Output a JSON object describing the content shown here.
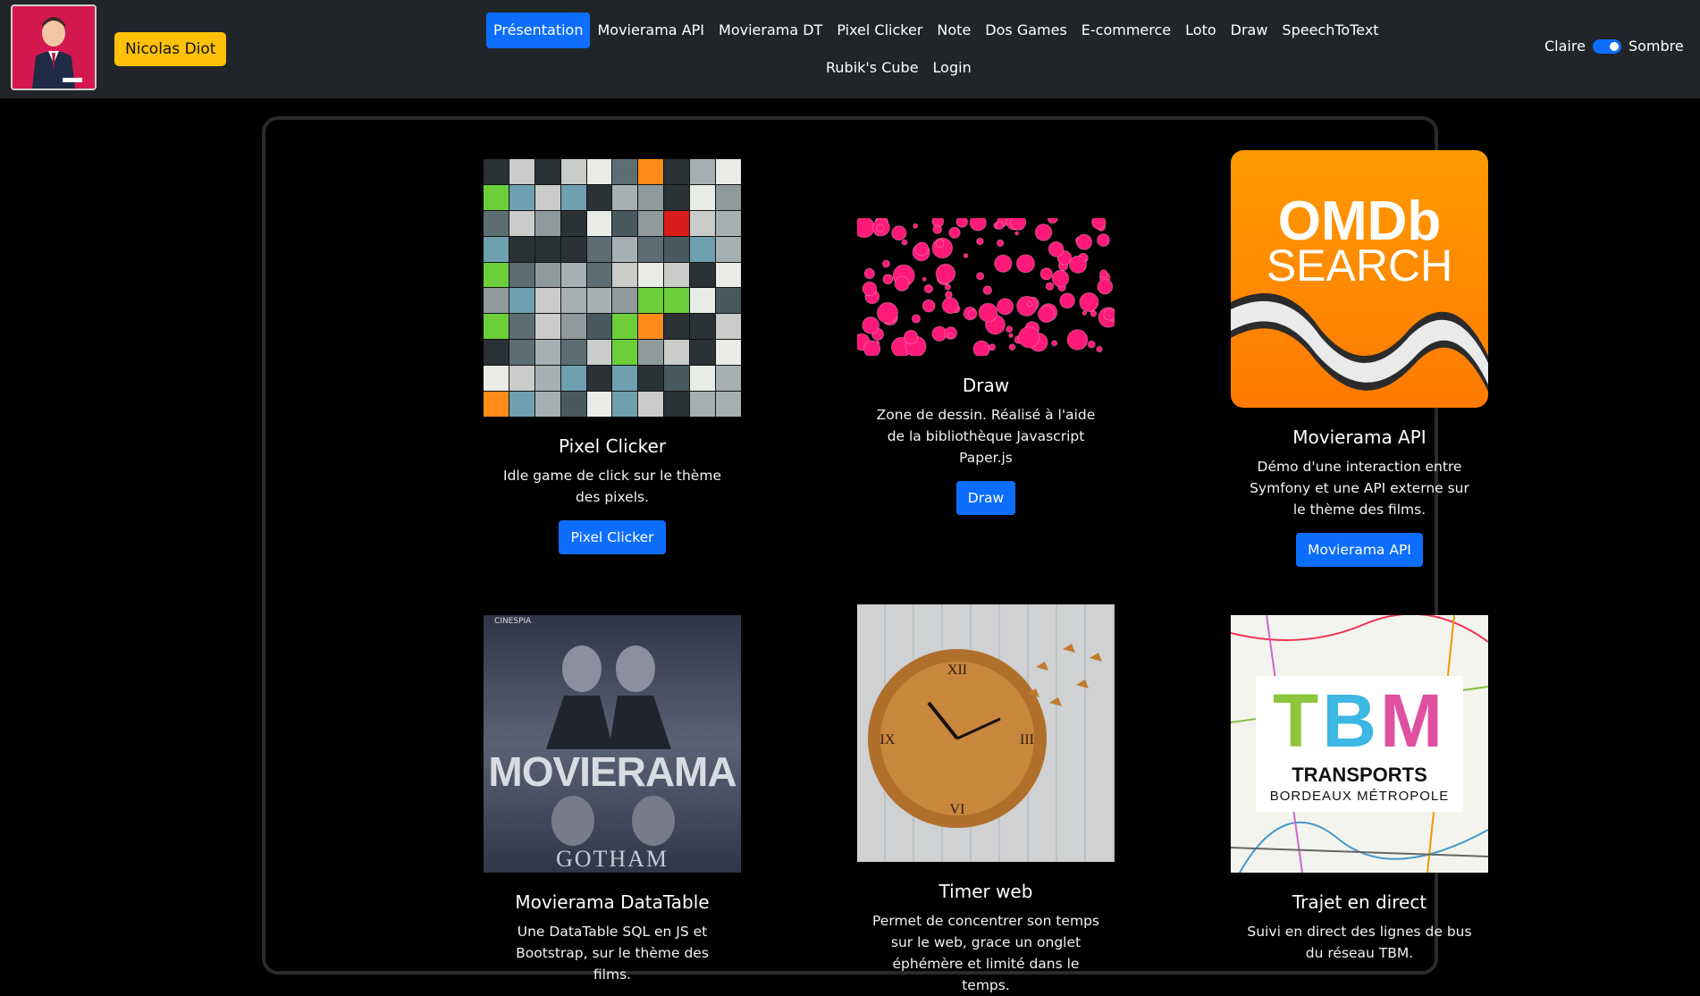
{
  "header": {
    "brand": "Nicolas Diot",
    "nav_row1": [
      "Présentation",
      "Movierama API",
      "Movierama DT",
      "Pixel Clicker",
      "Note",
      "Dos Games",
      "E-commerce",
      "Loto",
      "Draw",
      "SpeechToText"
    ],
    "nav_row2": [
      "Rubik's Cube",
      "Login"
    ],
    "active_item": "Présentation",
    "theme": {
      "light_label": "Claire",
      "dark_label": "Sombre",
      "dark_enabled": true
    }
  },
  "cards": [
    {
      "title": "Pixel Clicker",
      "desc": "Idle game de click sur le thème des pixels.",
      "button": "Pixel Clicker"
    },
    {
      "title": "Draw",
      "desc": "Zone de dessin. Réalisé à l'aide de la bibliothèque Javascript Paper.js",
      "button": "Draw"
    },
    {
      "title": "Movierama API",
      "desc": "Démo d'une interaction entre Symfony et une API externe sur le thème des films.",
      "button": "Movierama API"
    },
    {
      "title": "Movierama DataTable",
      "desc": "Une DataTable SQL en JS et Bootstrap, sur le thème des films."
    },
    {
      "title": "Timer web",
      "desc": "Permet de concentrer son temps sur le web, grace un onglet éphémère et limité dans le temps."
    },
    {
      "title": "Trajet en direct",
      "desc": "Suivi en direct des lignes de bus du réseau TBM."
    }
  ],
  "images": {
    "omdb_line1": "OMDb",
    "omdb_line2": "SEARCH",
    "poster_big": "MOVIERAMA",
    "poster_small": "GOTHAM",
    "poster_tag": "CINESPIA",
    "tbm_logo": "TBM",
    "tbm_line1": "TRANSPORTS",
    "tbm_line2": "BORDEAUX MÉTROPOLE"
  },
  "colors": {
    "navbar": "#212529",
    "accent": "#0d6efd",
    "brand_bg": "#ffc107",
    "body_bg": "#000000"
  }
}
